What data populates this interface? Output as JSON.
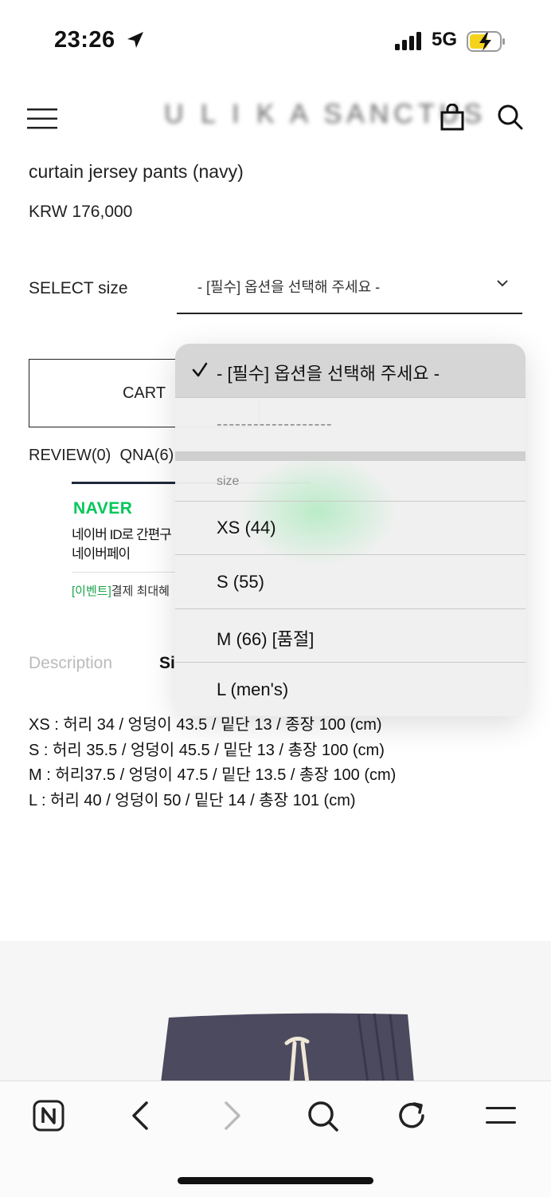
{
  "status_bar": {
    "time": "23:26",
    "network": "5G"
  },
  "header": {
    "brand": "U L I K A SANCTUS"
  },
  "product": {
    "title": "curtain jersey pants (navy)",
    "price": "KRW 176,000"
  },
  "option": {
    "label": "SELECT size",
    "selected_value": "- [필수] 옵션을 선택해 주세요 -"
  },
  "actions": {
    "cart": "CART"
  },
  "tabs": {
    "review": "REVIEW(0)",
    "qna": "QNA(6)"
  },
  "naver_pay": {
    "logo": "NAVER",
    "line1": "네이버 ID로 간편구",
    "line2": "네이버페이",
    "event_tag": "[이벤트]",
    "event_text": "결제 최대혜"
  },
  "info_tabs": {
    "description": "Description",
    "size": "Si"
  },
  "size_table": [
    "XS : 허리 34 / 엉덩이 43.5 / 밑단 13 / 종장 100 (cm)",
    "S : 허리 35.5 / 엉덩이  45.5 / 밑단 13 / 총장 100 (cm)",
    "M : 허리37.5 / 엉덩이 47.5 / 밑단 13.5 / 총장 100 (cm)",
    "L : 허리 40 / 엉덩이 50 / 밑단 14 / 총장 101 (cm)"
  ],
  "dropdown": {
    "selected": "- [필수] 옵션을 선택해 주세요 -",
    "divider": "-------------------",
    "group_label": "size",
    "options": [
      "XS (44)",
      "S (55)",
      "M (66) [품절]",
      "L (men's)"
    ]
  },
  "icons": {
    "status": [
      "location-arrow-icon",
      "signal-icon",
      "battery-charging-icon"
    ],
    "header": [
      "hamburger-menu-icon",
      "shopping-bag-icon",
      "search-icon"
    ],
    "bottom_bar": [
      "naver-home-icon",
      "back-arrow-icon",
      "forward-arrow-icon",
      "search-icon",
      "reload-icon",
      "menu-icon"
    ]
  },
  "colors": {
    "naver_green": "#03c75a",
    "battery": "#f5d31c"
  }
}
